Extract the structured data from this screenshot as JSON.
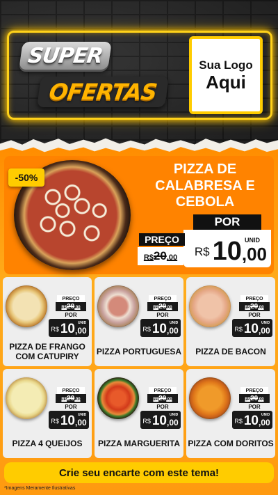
{
  "header": {
    "title_line1": "SUPER",
    "title_line2": "OFERTAS",
    "logo_line1": "Sua Logo",
    "logo_line2": "Aqui"
  },
  "featured": {
    "discount": "-50%",
    "name": "PIZZA DE CALABRESA E CEBOLA",
    "preco_label": "PREÇO",
    "old_currency": "R$",
    "old_int": "20",
    "old_dec": ",00",
    "por_label": "POR",
    "unid_label": "UNID",
    "currency": "R$",
    "price_int": "10",
    "price_dec": ",00"
  },
  "products": [
    {
      "name": "PIZZA DE FRANGO COM CATUPIRY",
      "preco_label": "PREÇO",
      "old_currency": "R$",
      "old_int": "20",
      "old_dec": ",00",
      "por_label": "POR",
      "unid_label": "UNID",
      "currency": "R$",
      "price_int": "10",
      "price_dec": ",00"
    },
    {
      "name": "PIZZA PORTUGUESA",
      "preco_label": "PREÇO",
      "old_currency": "R$",
      "old_int": "20",
      "old_dec": ",00",
      "por_label": "POR",
      "unid_label": "UNID",
      "currency": "R$",
      "price_int": "10",
      "price_dec": ",00"
    },
    {
      "name": "PIZZA DE BACON",
      "preco_label": "PREÇO",
      "old_currency": "R$",
      "old_int": "20",
      "old_dec": ",00",
      "por_label": "POR",
      "unid_label": "UNID",
      "currency": "R$",
      "price_int": "10",
      "price_dec": ",00"
    },
    {
      "name": "PIZZA 4 QUEIJOS",
      "preco_label": "PREÇO",
      "old_currency": "R$",
      "old_int": "20",
      "old_dec": ",00",
      "por_label": "POR",
      "unid_label": "UNID",
      "currency": "R$",
      "price_int": "10",
      "price_dec": ",00"
    },
    {
      "name": "PIZZA MARGUERITA",
      "preco_label": "PREÇO",
      "old_currency": "R$",
      "old_int": "20",
      "old_dec": ",00",
      "por_label": "POR",
      "unid_label": "UNID",
      "currency": "R$",
      "price_int": "10",
      "price_dec": ",00"
    },
    {
      "name": "PIZZA COM DORITOS",
      "preco_label": "PREÇO",
      "old_currency": "R$",
      "old_int": "20",
      "old_dec": ",00",
      "por_label": "POR",
      "unid_label": "UNID",
      "currency": "R$",
      "price_int": "10",
      "price_dec": ",00"
    }
  ],
  "banner": "Crie seu encarte com este tema!",
  "disclaimer": "*Imagens Meramente Ilustrativas",
  "colors": {
    "accent_yellow": "#ffcc00",
    "accent_orange": "#ff8300",
    "card_bg": "#eeeeee",
    "dark": "#111111"
  }
}
